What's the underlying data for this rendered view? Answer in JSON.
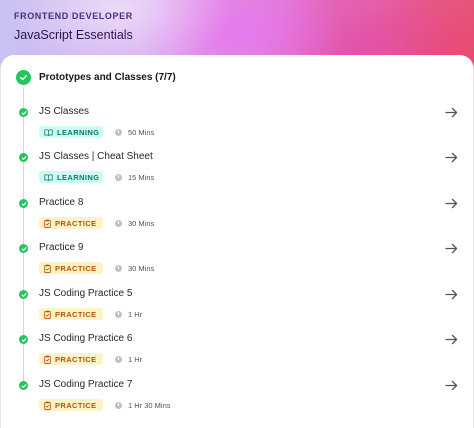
{
  "header": {
    "eyebrow": "FRONTEND DEVELOPER",
    "course_title": "JavaScript Essentials"
  },
  "section": {
    "title": "Prototypes and Classes (7/7)",
    "status": "completed"
  },
  "items": [
    {
      "title": "JS Classes",
      "type": "LEARNING",
      "duration": "50 Mins"
    },
    {
      "title": "JS Classes | Cheat Sheet",
      "type": "LEARNING",
      "duration": "15 Mins"
    },
    {
      "title": "Practice 8",
      "type": "PRACTICE",
      "duration": "30 Mins"
    },
    {
      "title": "Practice 9",
      "type": "PRACTICE",
      "duration": "30 Mins"
    },
    {
      "title": "JS Coding Practice 5",
      "type": "PRACTICE",
      "duration": "1 Hr"
    },
    {
      "title": "JS Coding Practice 6",
      "type": "PRACTICE",
      "duration": "1 Hr"
    },
    {
      "title": "JS Coding Practice 7",
      "type": "PRACTICE",
      "duration": "1 Hr 30 Mins"
    }
  ],
  "colors": {
    "complete": "#22c55e",
    "learning_bg": "#ccfbf1",
    "learning_text": "#0f766e",
    "practice_bg": "#fef3c7",
    "practice_text": "#b45309"
  },
  "icons": {
    "section_status": "check-circle-icon",
    "item_status": "check-circle-icon",
    "learning": "book-icon",
    "practice": "clipboard-icon",
    "duration": "clock-icon",
    "open": "arrow-right-icon"
  }
}
